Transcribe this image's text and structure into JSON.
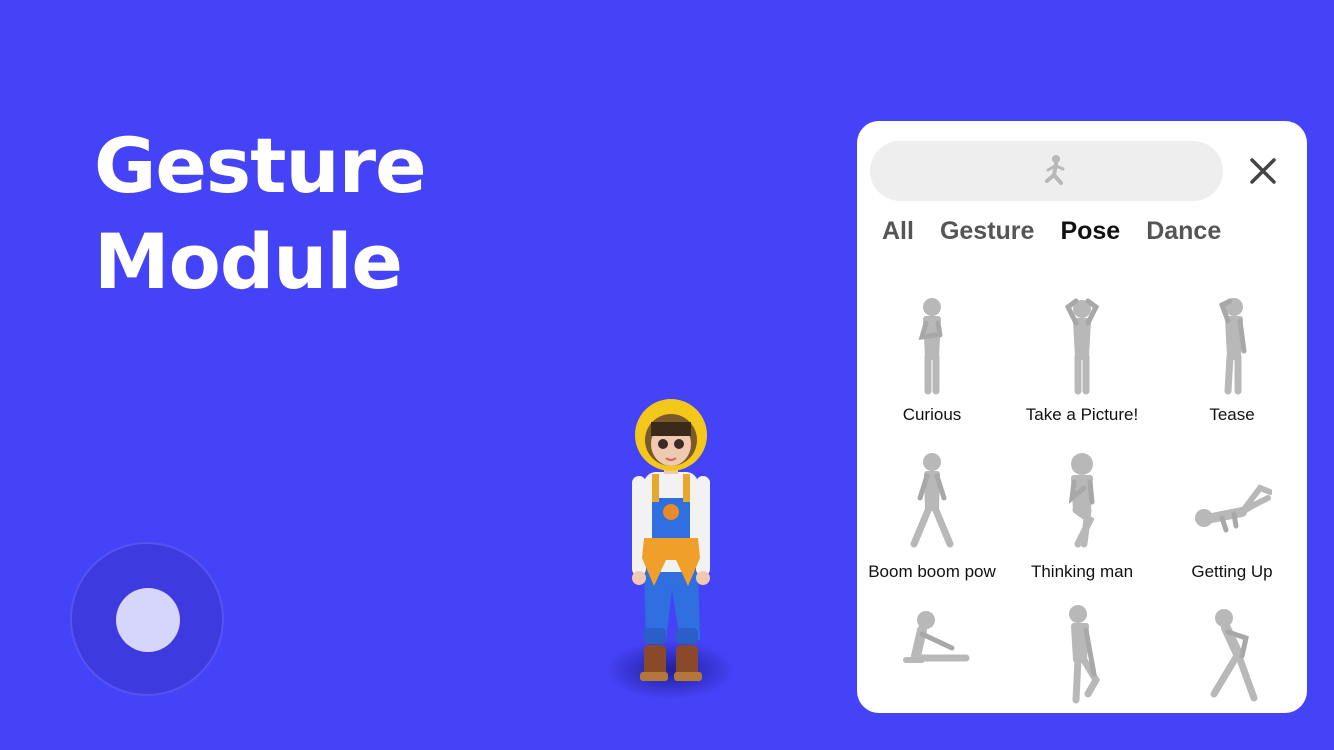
{
  "title": {
    "line1": "Gesture",
    "line2": "Module"
  },
  "colors": {
    "background": "#4543f7",
    "panel": "#ffffff",
    "search_bg": "#eeeeee",
    "tab_inactive": "#555555",
    "tab_active": "#111111",
    "figure": "#b8b8b8"
  },
  "panel": {
    "search_icon": "running-figure-icon",
    "close_icon": "close-icon",
    "tabs": [
      {
        "label": "All",
        "active": false
      },
      {
        "label": "Gesture",
        "active": false
      },
      {
        "label": "Pose",
        "active": true
      },
      {
        "label": "Dance",
        "active": false
      }
    ],
    "poses": [
      {
        "label": "Curious",
        "icon": "pose-curious-icon"
      },
      {
        "label": "Take a Picture!",
        "icon": "pose-take-picture-icon"
      },
      {
        "label": "Tease",
        "icon": "pose-tease-icon"
      },
      {
        "label": "Boom boom pow",
        "icon": "pose-boom-icon"
      },
      {
        "label": "Thinking man",
        "icon": "pose-thinking-icon"
      },
      {
        "label": "Getting Up",
        "icon": "pose-getting-up-icon"
      },
      {
        "label": "",
        "icon": "pose-stretch-icon"
      },
      {
        "label": "",
        "icon": "pose-leg-stretch-icon"
      },
      {
        "label": "",
        "icon": "pose-lunge-icon"
      }
    ]
  }
}
